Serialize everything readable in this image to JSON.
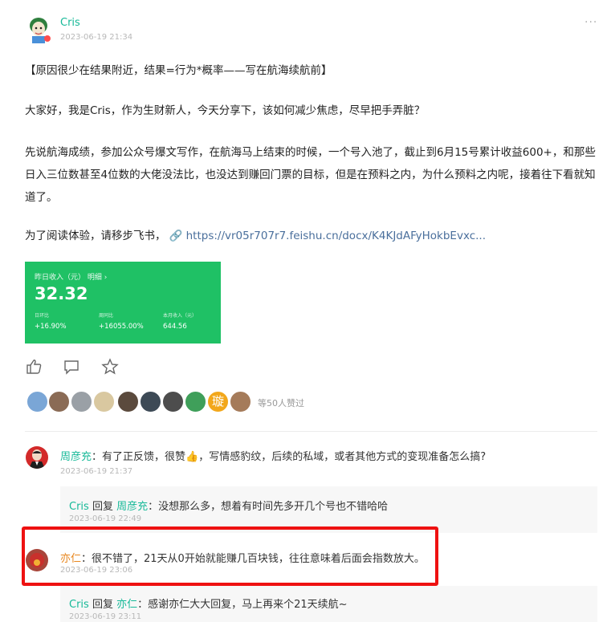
{
  "post": {
    "author": "Cris",
    "time": "2023-06-19 21:34",
    "more": "···",
    "p1": "【原因很少在结果附近，结果=行为*概率——写在航海续航前】",
    "p2": "大家好，我是Cris，作为生财新人，今天分享下，该如何减少焦虑，尽早把手弄脏？",
    "p3": "先说航海成绩，参加公众号爆文写作，在航海马上结束的时候，一个号入池了，截止到6月15号累计收益600+，和那些日入三位数甚至4位数的大佬没法比，也没达到赚回门票的目标，但是在预料之内，为什么预料之内呢，接着往下看就知道了。",
    "p4_prefix": "为了阅读体验，请移步飞书，",
    "link_text": "https://vr05r707r7.feishu.cn/docx/K4KJdAFyHokbEvxc..."
  },
  "income_card": {
    "header": "昨日收入（元）  明细 ›",
    "value": "32.32",
    "stats": [
      {
        "label": "日环比",
        "value": "+16.90%"
      },
      {
        "label": "周同比",
        "value": "+16055.00%"
      },
      {
        "label": "本月收入（元）",
        "value": "644.56"
      }
    ],
    "color": "#1fc165"
  },
  "actions": {
    "icons": [
      "thumbs-up-icon",
      "comment-icon",
      "star-icon"
    ]
  },
  "likes": {
    "count_text": "等50人赞过",
    "special_avatar_char": "璇"
  },
  "comments": [
    {
      "name": "周彦充",
      "text": "：有了正反馈，很赞👍，写情感豹纹，后续的私域，或者其他方式的变现准备怎么搞?",
      "time": "2023-06-19 21:37",
      "reply": {
        "from": "Cris",
        "verb": " 回复 ",
        "to": "周彦充",
        "text": "：没想那么多，想着有时间先多开几个号也不错哈哈",
        "time": "2023-06-19 22:49"
      }
    },
    {
      "name": "亦仁",
      "text": "：很不错了，21天从0开始就能赚几百块钱，往往意味着后面会指数放大。",
      "time": "2023-06-19 23:06",
      "reply": {
        "from": "Cris",
        "verb": " 回复 ",
        "to": "亦仁",
        "text": "：感谢亦仁大大回复，马上再来个21天续航~",
        "time": "2023-06-19 23:11"
      }
    }
  ],
  "colors": {
    "accent": "#16b998",
    "highlight": "#ee1111",
    "orange_name": "#e8871f"
  }
}
